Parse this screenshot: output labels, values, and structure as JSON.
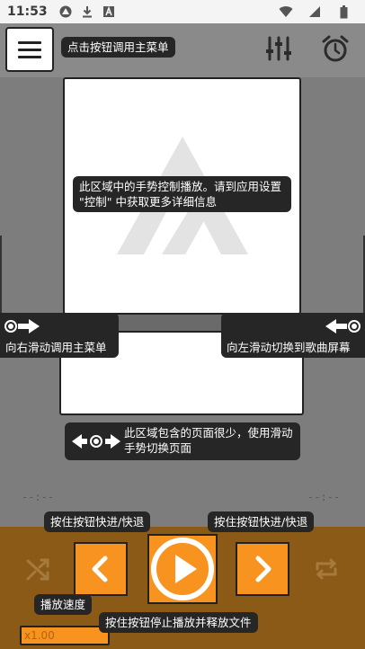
{
  "status_bar": {
    "time": "11:53",
    "icons_left": [
      "warning-triangle-icon",
      "download-icon",
      "app-a-icon"
    ],
    "icons_right": [
      "wifi-icon",
      "signal-icon",
      "battery-icon"
    ]
  },
  "header": {
    "menu_tip": "点击按钮调用主菜单",
    "icons": [
      "equalizer-icon",
      "alarm-icon"
    ]
  },
  "main": {
    "gesture_tip": "此区域中的手势控制播放。请到应用设置 \"控制\" 中获取更多详细信息",
    "swipe_right_tip": "向右滑动调用主菜单",
    "swipe_left_tip": "向左滑动切换到歌曲屏幕",
    "page_swipe_tip": "此区域包含的页面很少，使用滑动手势切换页面"
  },
  "player": {
    "time_elapsed": "--:--",
    "time_total": "--:--",
    "prev_tip": "按住按钮快进/快退",
    "next_tip": "按住按钮快进/快退",
    "speed_tip": "播放速度",
    "play_tip": "按住按钮停止播放并释放文件",
    "speed_value": "x1.00"
  },
  "colors": {
    "accent": "#f7931e",
    "control_bg": "#8b5a17",
    "background": "#7d7d7d",
    "tip_bg": "#262626"
  }
}
